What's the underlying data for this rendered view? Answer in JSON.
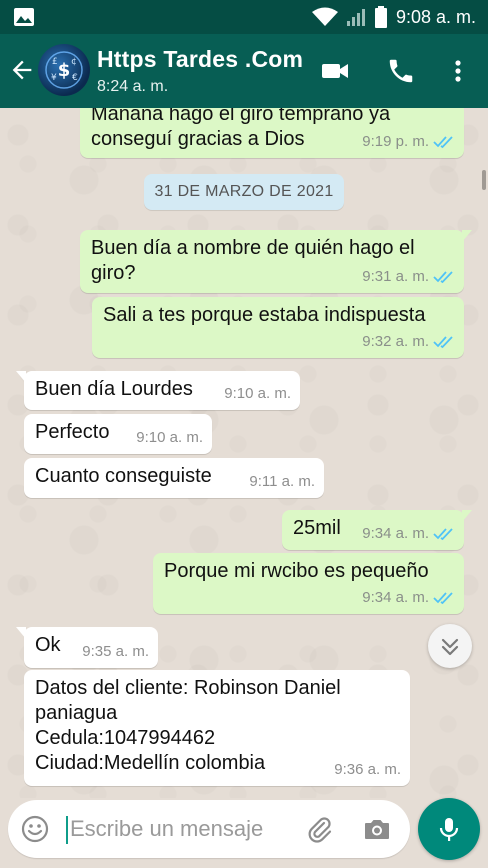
{
  "status_bar": {
    "time": "9:08 a. m."
  },
  "header": {
    "contact_name": "Https Tardes .Com",
    "last_seen": "8:24 a. m."
  },
  "chat": {
    "date_chip": "31 DE MARZO DE 2021",
    "messages": [
      {
        "direction": "out",
        "text": "Mañana hago el giro temprano ya\nconseguí gracias a Dios",
        "time": "9:19 p. m.",
        "status": "read"
      },
      {
        "direction": "out",
        "text": "Buen día a nombre de quién hago el\ngiro?",
        "time": "9:31 a. m.",
        "status": "read"
      },
      {
        "direction": "out",
        "text": "Sali a tes porque estaba indispuesta",
        "time": "9:32 a. m.",
        "status": "read"
      },
      {
        "direction": "in",
        "text": "Buen día Lourdes",
        "time": "9:10 a. m."
      },
      {
        "direction": "in",
        "text": "Perfecto",
        "time": "9:10 a. m."
      },
      {
        "direction": "in",
        "text": "Cuanto conseguiste",
        "time": "9:11 a. m."
      },
      {
        "direction": "out",
        "text": "25mil",
        "time": "9:34 a. m.",
        "status": "read"
      },
      {
        "direction": "out",
        "text": "Porque mi rwcibo es pequeño",
        "time": "9:34 a. m.",
        "status": "read"
      },
      {
        "direction": "in",
        "text": "Ok",
        "time": "9:35 a. m."
      },
      {
        "direction": "in",
        "text": "Datos del cliente: Robinson Daniel\npaniagua\nCedula:1047994462\nCiudad:Medellín colombia",
        "time": "9:36 a. m."
      }
    ]
  },
  "composer": {
    "placeholder": "Escribe un mensaje"
  },
  "colors": {
    "header": "#075e54",
    "status_bar": "#054d44",
    "outgoing": "#dcf8c6",
    "incoming": "#ffffff",
    "accent": "#00897b",
    "read_ticks": "#4fc3f7",
    "chat_bg": "#e5ddd5"
  },
  "icons": [
    "image-icon",
    "wifi-icon",
    "signal-icon",
    "battery-icon",
    "back-arrow-icon",
    "video-call-icon",
    "phone-icon",
    "more-vert-icon",
    "double-check-icon",
    "chevron-double-down-icon",
    "emoji-icon",
    "attach-icon",
    "camera-icon",
    "mic-icon"
  ]
}
